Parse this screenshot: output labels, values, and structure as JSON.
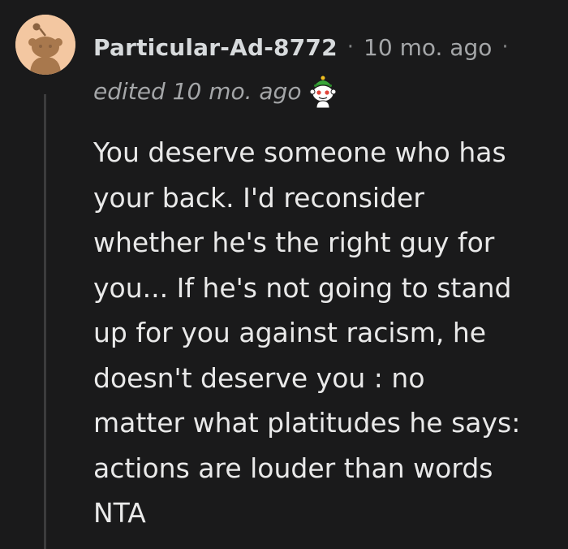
{
  "comment": {
    "username": "Particular-Ad-8772",
    "separator": "·",
    "timestamp": "10 mo. ago",
    "edited": "edited 10 mo. ago",
    "award_icon": "snoo-helmet-award-icon",
    "avatar_icon": "snoo-avatar-icon",
    "body_lines": [
      "You deserve someone who has",
      "your back. I'd reconsider",
      "whether he's the right guy for",
      "you... If he's not going to stand",
      "up for you against racism, he",
      "doesn't deserve you : no",
      "matter what platitudes he says:",
      "actions are louder than words",
      "NTA"
    ]
  },
  "colors": {
    "background": "#1a1a1b",
    "text": "#e9e9e9",
    "muted": "#a4a6a8",
    "avatar_bg": "#f3c7a1",
    "thread_line": "#3c3c3d"
  }
}
